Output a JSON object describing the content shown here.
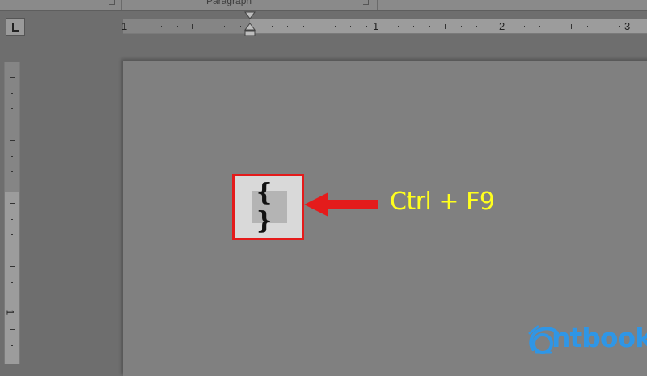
{
  "ribbon": {
    "group_label": "Paragraph"
  },
  "ruler": {
    "horizontal_numbers": [
      "1",
      "1",
      "2",
      "3"
    ],
    "vertical_numbers": [
      "1"
    ]
  },
  "field": {
    "braces": "{ }"
  },
  "annotation": {
    "shortcut": "Ctrl + F9"
  },
  "watermark": {
    "brand": "ntbook"
  },
  "colors": {
    "highlight_border": "#e41b1b",
    "arrow": "#e41b1b",
    "shortcut_text": "#ffff1e",
    "logo": "#2f96e6"
  },
  "icons": {
    "tab_selector": "left-tab-stop-icon",
    "indent": "hanging-indent-marker-icon",
    "arrow": "left-arrow-icon"
  }
}
